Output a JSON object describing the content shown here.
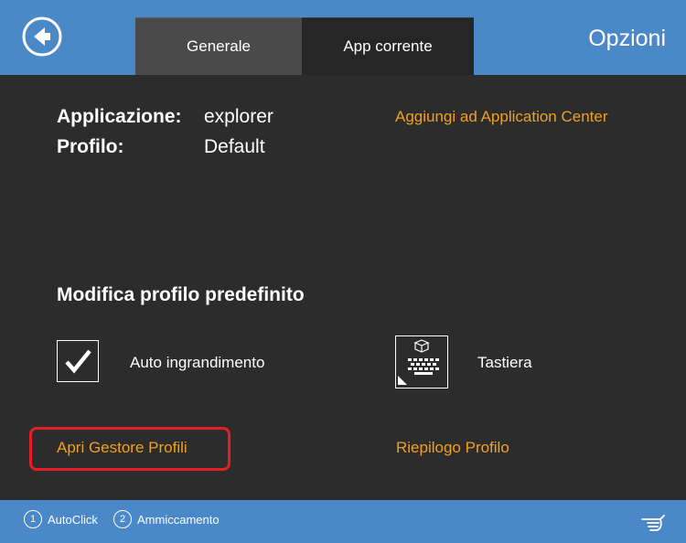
{
  "header": {
    "title": "Opzioni",
    "tabs": [
      {
        "label": "Generale"
      },
      {
        "label": "App corrente"
      }
    ]
  },
  "info": {
    "app_label": "Applicazione:",
    "app_value": "explorer",
    "profile_label": "Profilo:",
    "profile_value": "Default",
    "add_link": "Aggiungi ad Application Center"
  },
  "edit": {
    "title": "Modifica profilo predefinito",
    "auto_zoom_label": "Auto ingrandimento",
    "auto_zoom_checked": true,
    "keyboard_label": "Tastiera"
  },
  "links": {
    "profile_manager": "Apri Gestore Profili",
    "profile_summary": "Riepilogo Profilo"
  },
  "footer": {
    "items": [
      {
        "number": "1",
        "label": "AutoClick"
      },
      {
        "number": "2",
        "label": "Ammiccamento"
      }
    ]
  },
  "colors": {
    "accent_blue": "#4a88c7",
    "link_orange": "#f0a020",
    "panel_dark": "#2c2c2c",
    "highlight_red": "#e31e24"
  }
}
